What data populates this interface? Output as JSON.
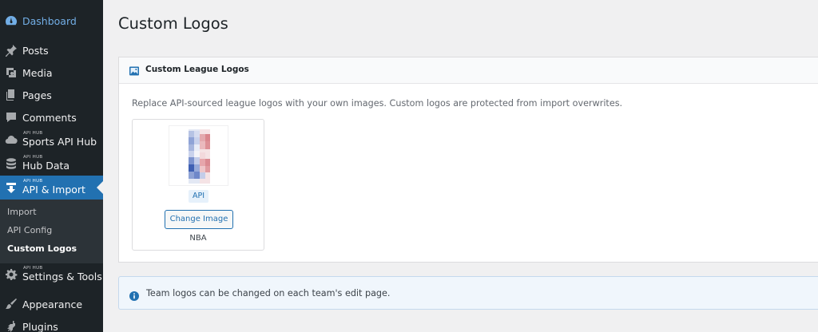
{
  "sidebar": {
    "items": [
      {
        "label": "Dashboard",
        "icon": "dashboard-icon"
      },
      {
        "label": "Posts",
        "icon": "pin-icon"
      },
      {
        "label": "Media",
        "icon": "media-icon"
      },
      {
        "label": "Pages",
        "icon": "pages-icon"
      },
      {
        "label": "Comments",
        "icon": "comment-icon"
      },
      {
        "label": "Sports API Hub",
        "tag": "API HUB",
        "icon": "cloud-icon"
      },
      {
        "label": "Hub Data",
        "tag": "API HUB",
        "icon": "database-icon"
      },
      {
        "label": "API & Import",
        "tag": "API HUB",
        "icon": "import-icon"
      },
      {
        "label": "Settings & Tools",
        "tag": "API HUB",
        "icon": "gear-icon"
      },
      {
        "label": "Appearance",
        "icon": "paintbrush-icon"
      },
      {
        "label": "Plugins",
        "icon": "plugin-icon"
      }
    ],
    "submenu": [
      {
        "label": "Import"
      },
      {
        "label": "API Config"
      },
      {
        "label": "Custom Logos",
        "current": true
      }
    ]
  },
  "page": {
    "title": "Custom Logos"
  },
  "card": {
    "title": "Custom League Logos",
    "description": "Replace API-sourced league logos with your own images. Custom logos are protected from import overwrites.",
    "logos": [
      {
        "source_badge": "API",
        "button_label": "Change Image",
        "league": "NBA"
      }
    ]
  },
  "notice": {
    "text": "Team logos can be changed on each team's edit page."
  },
  "colors": {
    "sidebar_bg": "#1d2327",
    "accent": "#2271b1",
    "notice_bg": "#f0f6fc"
  }
}
